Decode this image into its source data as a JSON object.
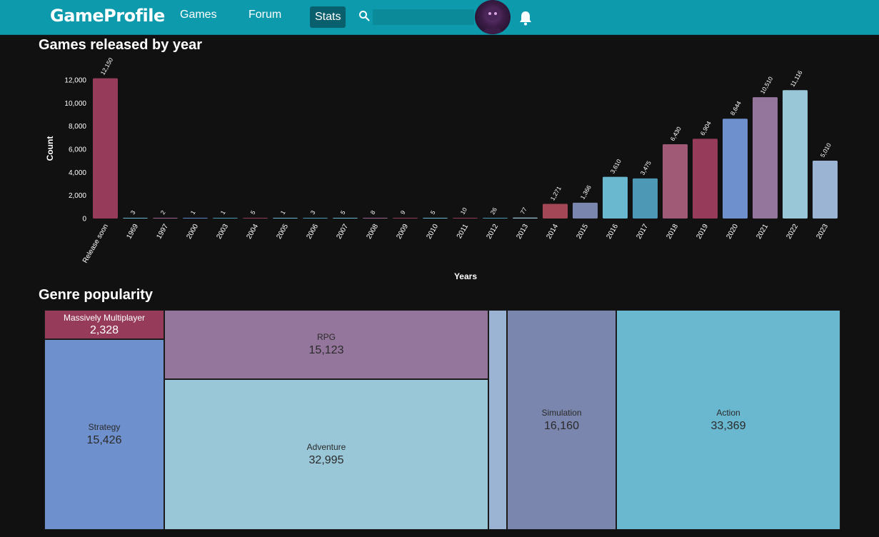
{
  "navbar": {
    "brand": "GameProfile",
    "links": [
      {
        "label": "Games"
      },
      {
        "label": "Forum"
      },
      {
        "label": "Stats",
        "active": true
      }
    ],
    "search": {
      "placeholder": "",
      "value": ""
    },
    "icons": [
      "search-icon",
      "avatar",
      "bell-icon"
    ],
    "color": "#0e9aad"
  },
  "chart1": {
    "title": "Games released by year"
  },
  "chart_data": [
    {
      "type": "bar",
      "title": "Games released by year",
      "xlabel": "Years",
      "ylabel": "Count",
      "ylim": [
        0,
        12000
      ],
      "yticks": [
        "0",
        "2,000",
        "4,000",
        "6,000",
        "8,000",
        "10,000",
        "12,000"
      ],
      "grid": false,
      "categories": [
        "Release soon",
        "1969",
        "1997",
        "2000",
        "2003",
        "2004",
        "2005",
        "2006",
        "2007",
        "2008",
        "2009",
        "2010",
        "2011",
        "2012",
        "2013",
        "2014",
        "2015",
        "2016",
        "2017",
        "2018",
        "2019",
        "2020",
        "2021",
        "2022",
        "2023"
      ],
      "values": [
        12150,
        3,
        2,
        1,
        1,
        5,
        1,
        3,
        5,
        8,
        9,
        5,
        10,
        26,
        77,
        1271,
        1366,
        3610,
        3475,
        6430,
        6904,
        8644,
        10510,
        11116,
        5010
      ],
      "value_labels": [
        "12,150",
        "3",
        "2",
        "1",
        "1",
        "5",
        "1",
        "3",
        "5",
        "8",
        "9",
        "5",
        "10",
        "26",
        "77",
        "1,271",
        "1,366",
        "3,610",
        "3,475",
        "6,430",
        "6,904",
        "8,644",
        "10,510",
        "11,116",
        "5,010"
      ],
      "colors": [
        "#963c5a",
        "#6ab7d0",
        "#9b6590",
        "#5d89c9",
        "#4c98b5",
        "#963c5a",
        "#6ab7d0",
        "#4c98b5",
        "#6ab7d0",
        "#9b6590",
        "#963c5a",
        "#6ab7d0",
        "#963c5a",
        "#4c98b5",
        "#9ac7d8",
        "#a34656",
        "#7a86ad",
        "#6ab7d0",
        "#4c98b5",
        "#a05a76",
        "#963c5a",
        "#6e90cc",
        "#94769c",
        "#9ac7d8",
        "#9cb4d4"
      ]
    },
    {
      "type": "treemap",
      "title": "Genre popularity",
      "items": [
        {
          "name": "Massively Multiplayer",
          "value": 2328,
          "label": "2,328",
          "color": "#963c5a"
        },
        {
          "name": "Strategy",
          "value": 15426,
          "label": "15,426",
          "color": "#6e90cc"
        },
        {
          "name": "RPG",
          "value": 15123,
          "label": "15,123",
          "color": "#94769c"
        },
        {
          "name": "Adventure",
          "value": 32995,
          "label": "32,995",
          "color": "#9ac7d8"
        },
        {
          "name": "",
          "value": null,
          "label": "",
          "color": "#9cb4d4"
        },
        {
          "name": "Simulation",
          "value": 16160,
          "label": "16,160",
          "color": "#7a86ad"
        },
        {
          "name": "Action",
          "value": 33369,
          "label": "33,369",
          "color": "#6ab7d0"
        }
      ]
    }
  ],
  "chart2": {
    "title": "Genre popularity"
  }
}
